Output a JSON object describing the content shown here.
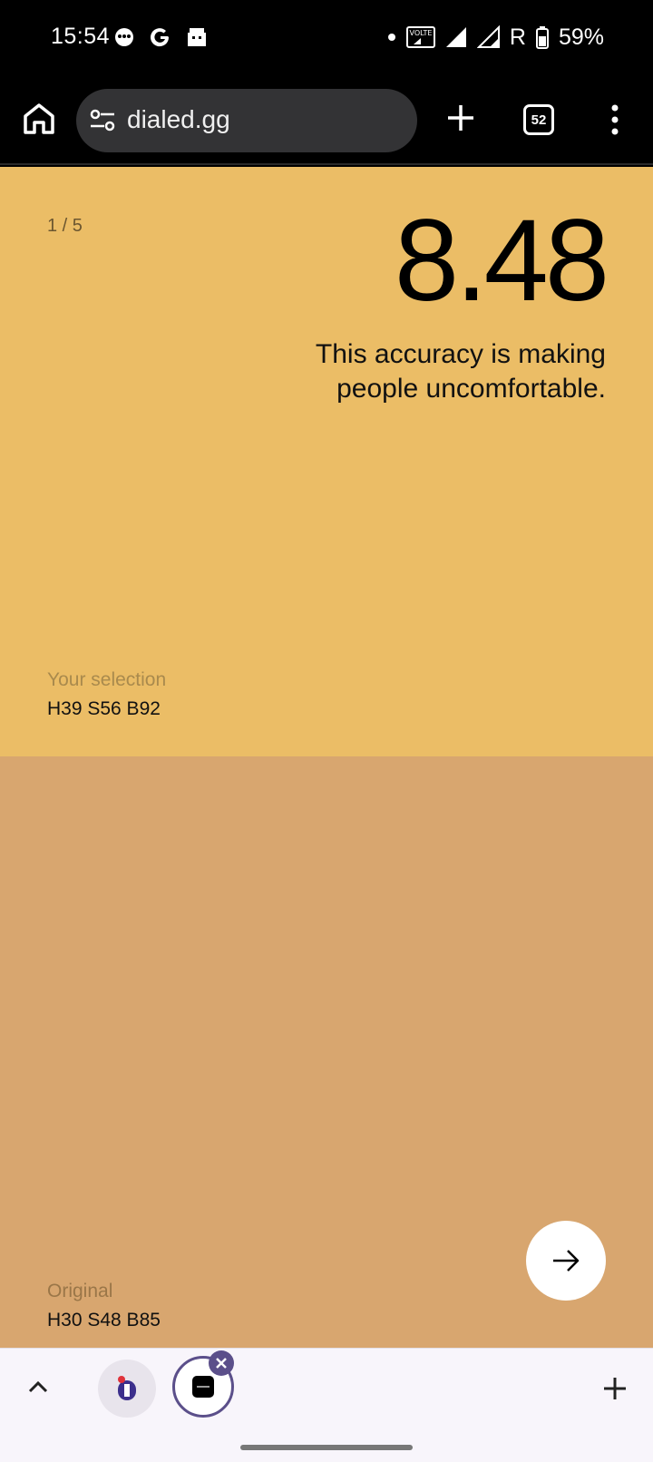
{
  "status_bar": {
    "time": "15:54",
    "battery": "59%",
    "roaming": "R",
    "volte": "VOLTE"
  },
  "toolbar": {
    "url": "dialed.gg",
    "tab_count": "52"
  },
  "result": {
    "round": "1 / 5",
    "score": "8.48",
    "comment": "This accuracy is making people uncomfortable.",
    "selection_label": "Your selection",
    "selection_value": "H39 S56 B92",
    "original_label": "Original",
    "original_value": "H30 S48 B85",
    "selection_color": "#EBBD66",
    "original_color": "#D8A66F"
  },
  "icons": {
    "home": "home-icon",
    "tune": "tune-icon",
    "add": "plus-icon",
    "menu": "more-vert-icon",
    "next": "arrow-right-icon",
    "chevron": "chevron-up-icon",
    "close": "close-icon"
  }
}
